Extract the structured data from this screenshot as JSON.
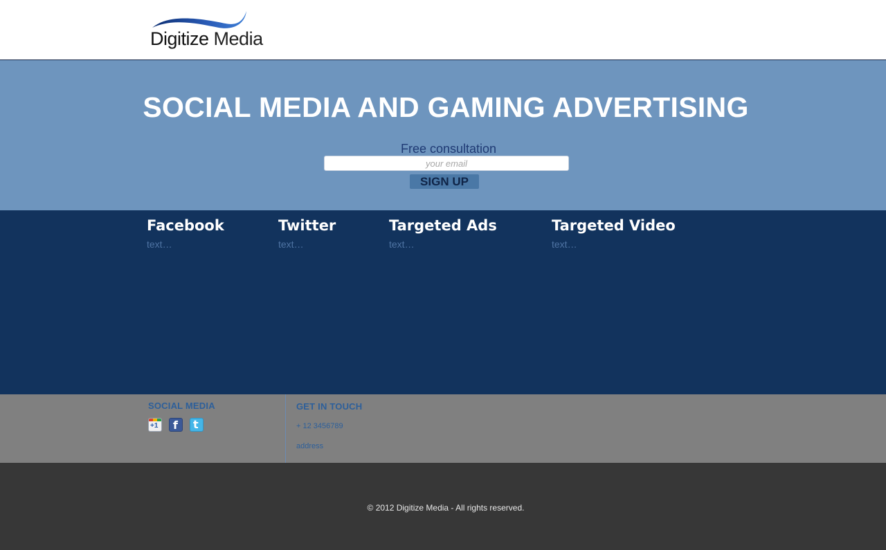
{
  "header": {
    "logo": {
      "word_bold": "Digitize",
      "word_light": "Media"
    }
  },
  "hero": {
    "title": "SOCIAL MEDIA AND GAMING ADVERTISING",
    "consult_label": "Free consultation",
    "email_placeholder": "your email",
    "signup_label": "SIGN UP"
  },
  "services": [
    {
      "title": "Facebook",
      "text": "text…"
    },
    {
      "title": "Twitter",
      "text": "text…"
    },
    {
      "title": "Targeted Ads",
      "text": "text…"
    },
    {
      "title": "Targeted Video",
      "text": "text…"
    }
  ],
  "footer": {
    "social": {
      "heading": "SOCIAL MEDIA",
      "icons": [
        "google-plus-one-icon",
        "facebook-icon",
        "twitter-icon"
      ]
    },
    "contact": {
      "heading": "GET IN TOUCH",
      "phone": "+ 12 3456789",
      "address": "address"
    },
    "copyright": "© 2012 Digitize Media - All rights reserved."
  },
  "colors": {
    "hero_bg": "#6e95be",
    "services_bg": "#12335d",
    "footer_top_bg": "#808080",
    "footer_bottom_bg": "#373737",
    "accent_blue": "#2d5f9a"
  }
}
